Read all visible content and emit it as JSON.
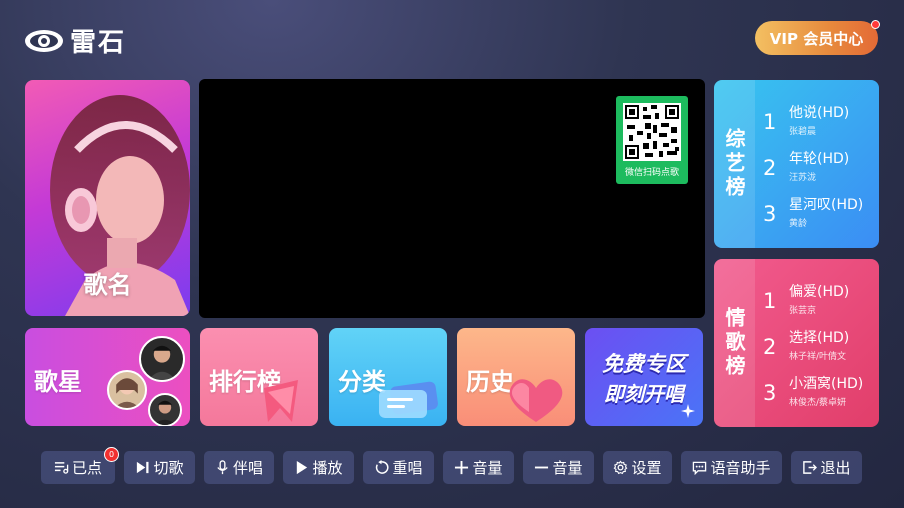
{
  "brand": {
    "name": "雷石"
  },
  "vip_button": {
    "label": "VIP 会员中心"
  },
  "song_card": {
    "label": "歌名"
  },
  "qr": {
    "caption": "微信扫码点歌"
  },
  "charts": [
    {
      "title": "综艺榜",
      "items": [
        {
          "rank": "1",
          "song": "他说(HD)",
          "artist": "张碧晨"
        },
        {
          "rank": "2",
          "song": "年轮(HD)",
          "artist": "汪苏泷"
        },
        {
          "rank": "3",
          "song": "星河叹(HD)",
          "artist": "黄龄"
        }
      ]
    },
    {
      "title": "情歌榜",
      "items": [
        {
          "rank": "1",
          "song": "偏爱(HD)",
          "artist": "张芸京"
        },
        {
          "rank": "2",
          "song": "选择(HD)",
          "artist": "林子祥/叶倩文"
        },
        {
          "rank": "3",
          "song": "小酒窝(HD)",
          "artist": "林俊杰/蔡卓妍"
        }
      ]
    }
  ],
  "tiles": {
    "singer": "歌星",
    "ranking": "排行榜",
    "category": "分类",
    "history": "历史",
    "free_line1": "免费专区",
    "free_line2": "即刻开唱"
  },
  "toolbar": {
    "ordered": "已点",
    "ordered_count": "0",
    "next": "切歌",
    "accompany": "伴唱",
    "play": "播放",
    "replay": "重唱",
    "vol_up": "音量",
    "vol_down": "音量",
    "settings": "设置",
    "voice": "语音助手",
    "exit": "退出"
  },
  "colors": {
    "vip_gradient": [
      "#f3c062",
      "#e46a36"
    ],
    "variety_chart": "#3b8df4",
    "love_chart": "#e13e6a",
    "qr_green": "#1dbb5e"
  }
}
